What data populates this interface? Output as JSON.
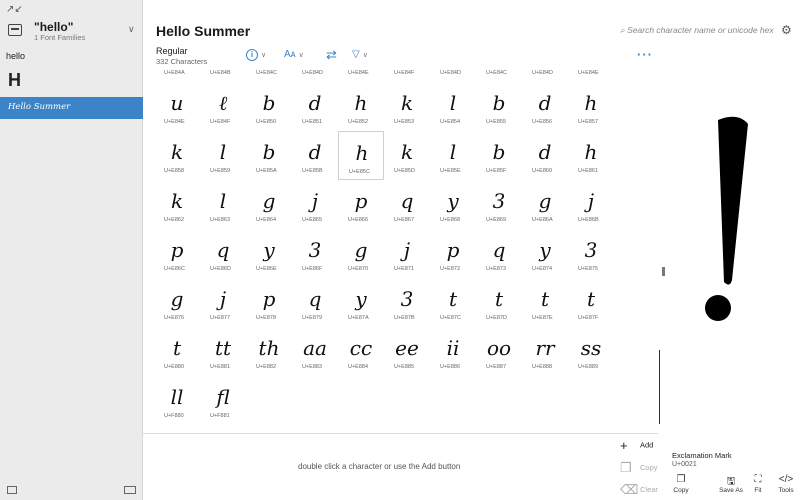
{
  "sidebar": {
    "family_name": "\"hello\"",
    "family_count": "1 Font Families",
    "preview_text": "hello",
    "preview_big": "H",
    "selected_font": "Hello Summer"
  },
  "header": {
    "title": "Hello Summer",
    "style": "Regular",
    "char_count": "332 Characters",
    "search_placeholder": "Search character name or unicode hex",
    "more_label": "···"
  },
  "grid": {
    "top_row": [
      "U+E84A",
      "U+E84B",
      "U+E84C",
      "U+E84D",
      "U+E84E",
      "U+E84F",
      "U+E84D",
      "U+E84C",
      "U+E84D",
      "U+E84E"
    ],
    "rows": [
      {
        "glyphs": [
          "u",
          "ℓ",
          "b",
          "d",
          "h",
          "k",
          "l",
          "b",
          "d",
          "h"
        ],
        "codes": [
          "U+E84E",
          "U+E84F",
          "U+E850",
          "U+E851",
          "U+E852",
          "U+E853",
          "U+E854",
          "U+E855",
          "U+E856",
          "U+E857"
        ]
      },
      {
        "glyphs": [
          "k",
          "l",
          "b",
          "d",
          "h",
          "k",
          "l",
          "b",
          "d",
          "h"
        ],
        "codes": [
          "U+E858",
          "U+E859",
          "U+E85A",
          "U+E85B",
          "U+E85C",
          "U+E85D",
          "U+E85E",
          "U+E85F",
          "U+E860",
          "U+E861"
        ]
      },
      {
        "glyphs": [
          "k",
          "l",
          "g",
          "j",
          "p",
          "q",
          "y",
          "3",
          "g",
          "j"
        ],
        "codes": [
          "U+E862",
          "U+E863",
          "U+E864",
          "U+E865",
          "U+E866",
          "U+E867",
          "U+E868",
          "U+E869",
          "U+E86A",
          "U+E86B"
        ]
      },
      {
        "glyphs": [
          "p",
          "q",
          "y",
          "3",
          "g",
          "j",
          "p",
          "q",
          "y",
          "3"
        ],
        "codes": [
          "U+E86C",
          "U+E86D",
          "U+E86E",
          "U+E86F",
          "U+E870",
          "U+E871",
          "U+E872",
          "U+E873",
          "U+E874",
          "U+E875"
        ]
      },
      {
        "glyphs": [
          "g",
          "j",
          "p",
          "q",
          "y",
          "3",
          "t",
          "t",
          "t",
          "t"
        ],
        "codes": [
          "U+E876",
          "U+E877",
          "U+E878",
          "U+E879",
          "U+E87A",
          "U+E87B",
          "U+E87C",
          "U+E87D",
          "U+E87E",
          "U+E87F"
        ]
      },
      {
        "glyphs": [
          "t",
          "tt",
          "th",
          "aa",
          "cc",
          "ee",
          "ii",
          "oo",
          "rr",
          "ss"
        ],
        "codes": [
          "U+E880",
          "U+E881",
          "U+E882",
          "U+E883",
          "U+E884",
          "U+E885",
          "U+E886",
          "U+E887",
          "U+E888",
          "U+E889"
        ]
      },
      {
        "glyphs": [
          "ll",
          "fl"
        ],
        "codes": [
          "U+F880",
          "U+F881"
        ]
      }
    ]
  },
  "bottom": {
    "hint": "double click a character or use the Add button",
    "add": "Add",
    "copy": "Copy",
    "clear": "Clear"
  },
  "detail": {
    "glyph": "!",
    "name": "Exclamation Mark",
    "code": "U+0021",
    "actions": [
      "Copy",
      "Save As",
      "Fit",
      "Tools"
    ]
  }
}
